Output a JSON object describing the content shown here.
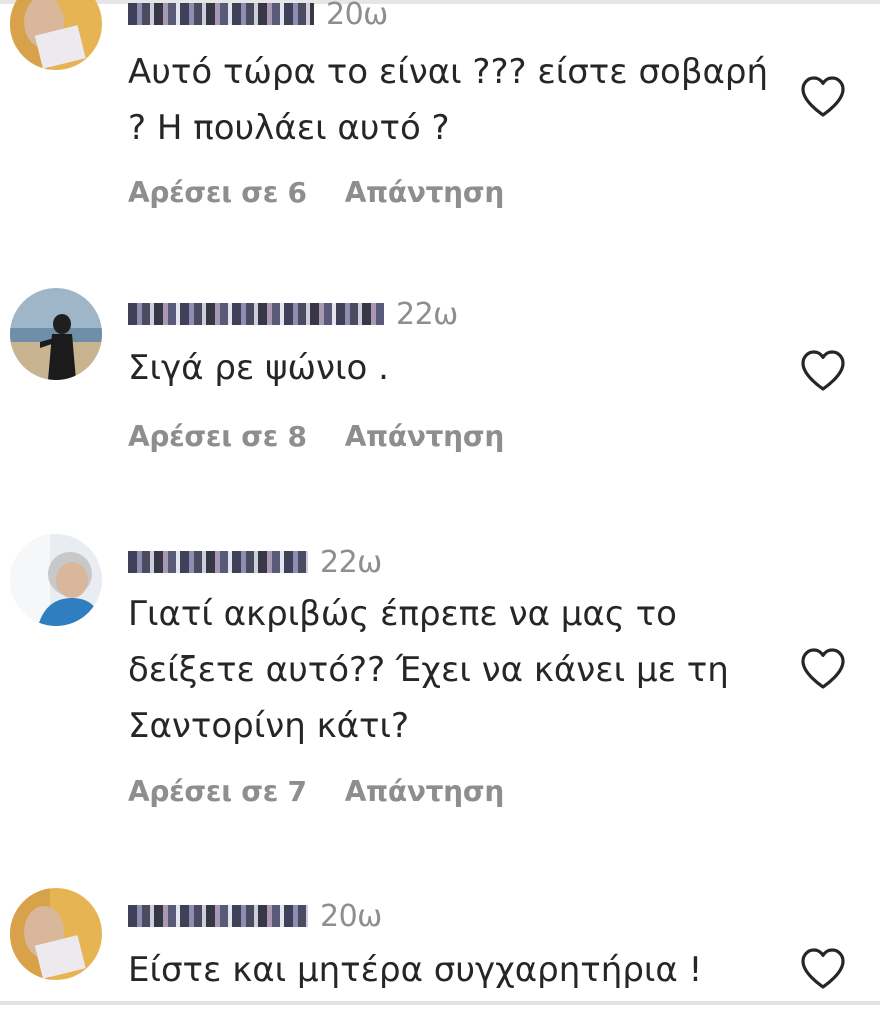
{
  "comments": [
    {
      "time": "20ω",
      "text": "Αυτό τώρα το είναι ??? είστε σοβαρή ? Η πουλάει αυτό ?",
      "likes": "Αρέσει σε 6",
      "reply": "Απάντηση"
    },
    {
      "time": "22ω",
      "text": "Σιγά ρε ψώνιο .",
      "likes": "Αρέσει σε 8",
      "reply": "Απάντηση"
    },
    {
      "time": "22ω",
      "text": "Γιατί ακριβώς έπρεπε να μας το δείξετε αυτό?? Έχει να κάνει με τη Σαντορίνη κάτι?",
      "likes": "Αρέσει σε 7",
      "reply": "Απάντηση"
    },
    {
      "time": "20ω",
      "text": "Είστε και μητέρα συγχαρητήρια !",
      "likes": "",
      "reply": ""
    }
  ],
  "colors": {
    "text": "#262626",
    "muted": "#8e8e8e",
    "heart_stroke": "#262626"
  },
  "icons": {
    "like": "heart-outline-icon"
  }
}
